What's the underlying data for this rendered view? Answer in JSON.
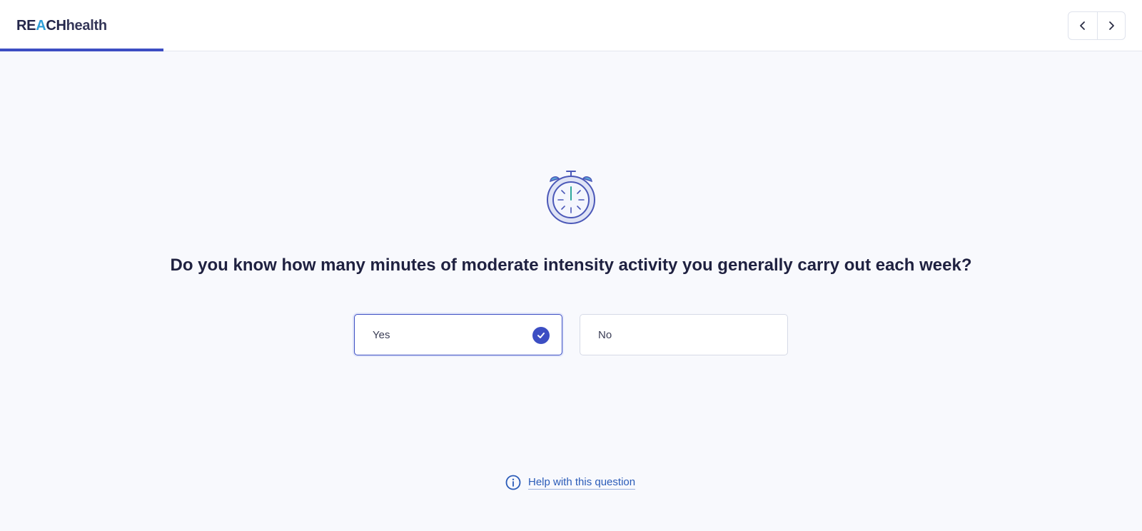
{
  "header": {
    "logo": {
      "part1": "RE",
      "part2": "A",
      "part3": "CH",
      "part4": "health"
    },
    "progress_fraction": 0.143,
    "nav": {
      "prev_icon": "chevron-left-icon",
      "next_icon": "chevron-right-icon"
    }
  },
  "main": {
    "illustration_icon": "stopwatch-icon",
    "question": "Do you know how many minutes of moderate intensity activity you generally carry out each week?",
    "options": [
      {
        "label": "Yes",
        "selected": true
      },
      {
        "label": "No",
        "selected": false
      }
    ],
    "help_link": "Help with this question",
    "help_icon": "info-icon"
  },
  "colors": {
    "accent": "#3c4ec3",
    "background": "#f8f9fd",
    "logo_accent": "#2f9fd8",
    "link": "#2a5bb8"
  }
}
